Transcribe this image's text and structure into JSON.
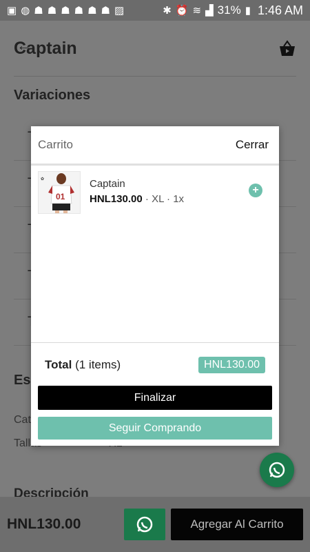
{
  "status_bar": {
    "battery": "31%",
    "time": "1:46 AM"
  },
  "page": {
    "title": "Captain",
    "variations_title": "Variaciones",
    "variation_rows": [
      "Ta",
      "Ta",
      "Ta",
      "Ta",
      "Ta"
    ],
    "specs_title_partial": "Es",
    "specs": [
      {
        "label": "Cat",
        "value": ""
      },
      {
        "label": "Tallas",
        "value": "XL"
      }
    ],
    "description_title": "Descripción"
  },
  "footer": {
    "price": "HNL130.00",
    "add_to_cart": "Agregar Al Carrito"
  },
  "modal": {
    "title": "Carrito",
    "close": "Cerrar",
    "items": [
      {
        "name": "Captain",
        "price": "HNL130.00",
        "size": "XL",
        "qty": "1x"
      }
    ],
    "total_label": "Total",
    "total_items": "(1 items)",
    "total_value": "HNL130.00",
    "finalize": "Finalizar",
    "keep_shopping": "Seguir Comprando"
  },
  "colors": {
    "accent": "#6ec0ad",
    "whatsapp": "#1a7a4b"
  }
}
